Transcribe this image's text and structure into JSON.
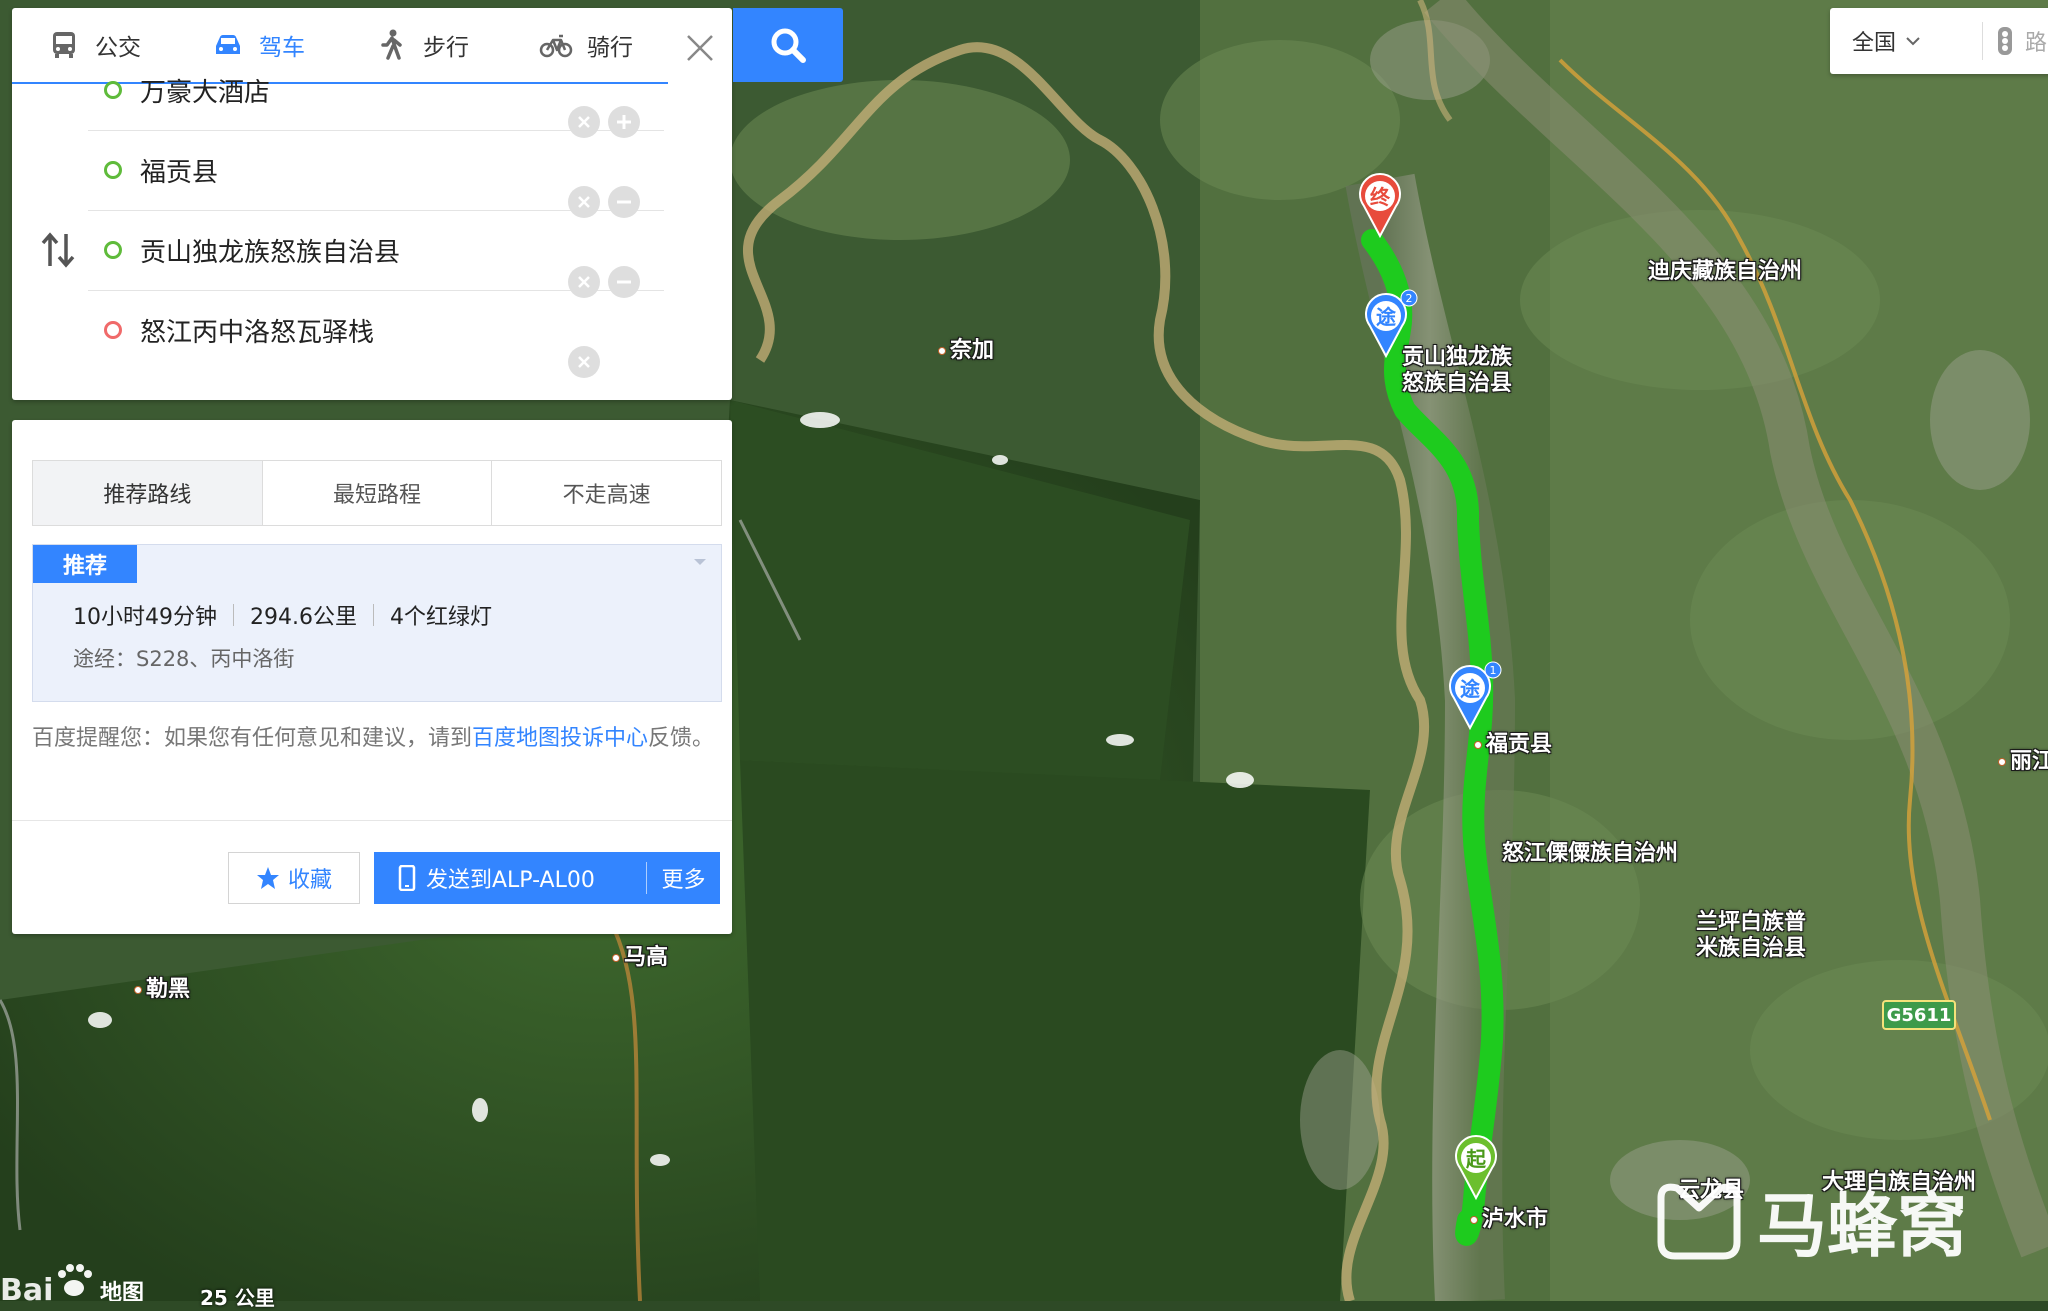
{
  "modes": [
    {
      "label": "公交",
      "icon": "bus-icon",
      "active": false
    },
    {
      "label": "驾车",
      "icon": "car-icon",
      "active": true
    },
    {
      "label": "步行",
      "icon": "walk-icon",
      "active": false
    },
    {
      "label": "骑行",
      "icon": "bike-icon",
      "active": false
    }
  ],
  "stops": [
    {
      "value": "万豪大酒店",
      "type": "start"
    },
    {
      "value": "福贡县",
      "type": "via"
    },
    {
      "value": "贡山独龙族怒族自治县",
      "type": "via"
    },
    {
      "value": "怒江丙中洛怒瓦驿栈",
      "type": "end"
    }
  ],
  "preference_tabs": [
    "推荐路线",
    "最短路程",
    "不走高速"
  ],
  "route": {
    "badge": "推荐",
    "duration": "10小时49分钟",
    "distance": "294.6公里",
    "lights": "4个红绿灯",
    "via": "途经：S228、丙中洛街"
  },
  "feedback": {
    "prefix": "百度提醒您：如果您有任何意见和建议，请到",
    "link": "百度地图投诉中心",
    "suffix": "反馈。"
  },
  "actions": {
    "favorite": "收藏",
    "send": "发送到ALP-AL00",
    "more": "更多"
  },
  "top_right": {
    "region": "全国",
    "traffic": "路况"
  },
  "map_labels": {
    "naijia": "奈加",
    "gongshan_line1": "贡山独龙族",
    "gongshan_line2": "怒族自治县",
    "fugong": "福贡县",
    "nujiang_pref": "怒江傈僳族自治州",
    "diqing": "迪庆藏族自治州",
    "lanping_line1": "兰坪白族普",
    "lanping_line2": "米族自治县",
    "lijiang": "丽江",
    "magao": "马高",
    "lehei": "勒黑",
    "yunlong": "云龙县",
    "dali": "大理白族自治州",
    "lushui": "泸水市",
    "highway": "G5611"
  },
  "markers": {
    "end": "终",
    "via": "途",
    "start": "起",
    "via1_index": "1",
    "via2_index": "2"
  },
  "scale": "25 公里",
  "logo_text": "地图",
  "watermark": "马蜂窝",
  "colors": {
    "accent": "#3385ff",
    "route": "#1ecb1e",
    "start": "#6cbf2e",
    "end": "#e84b3c"
  }
}
